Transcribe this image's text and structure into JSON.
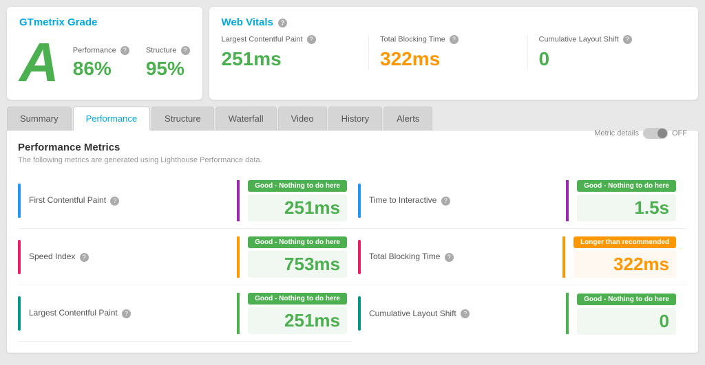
{
  "header": {
    "grade_title": "GTmetrix Grade",
    "grade_letter": "A",
    "performance_label": "Performance",
    "performance_value": "86%",
    "structure_label": "Structure",
    "structure_value": "95%",
    "web_vitals_title": "Web Vitals",
    "lcp_label": "Largest Contentful Paint",
    "lcp_value": "251ms",
    "tbt_label": "Total Blocking Time",
    "tbt_value": "322ms",
    "cls_label": "Cumulative Layout Shift",
    "cls_value": "0"
  },
  "tabs": [
    {
      "label": "Summary",
      "active": false
    },
    {
      "label": "Performance",
      "active": true
    },
    {
      "label": "Structure",
      "active": false
    },
    {
      "label": "Waterfall",
      "active": false
    },
    {
      "label": "Video",
      "active": false
    },
    {
      "label": "History",
      "active": false
    },
    {
      "label": "Alerts",
      "active": false
    }
  ],
  "performance": {
    "title": "Performance Metrics",
    "subtitle": "The following metrics are generated using Lighthouse Performance data.",
    "metric_details_label": "Metric details",
    "toggle_label": "OFF",
    "metrics": [
      {
        "name": "First Contentful Paint",
        "badge": "Good - Nothing to do here",
        "badge_type": "green",
        "value": "251ms",
        "value_type": "green",
        "bar_color": "blue",
        "sep_color": "purple"
      },
      {
        "name": "Time to Interactive",
        "badge": "Good - Nothing to do here",
        "badge_type": "green",
        "value": "1.5s",
        "value_type": "green",
        "bar_color": "blue",
        "sep_color": "purple"
      },
      {
        "name": "Speed Index",
        "badge": "Good - Nothing to do here",
        "badge_type": "green",
        "value": "753ms",
        "value_type": "green",
        "bar_color": "pink",
        "sep_color": "orange"
      },
      {
        "name": "Total Blocking Time",
        "badge": "Longer than recommended",
        "badge_type": "orange",
        "value": "322ms",
        "value_type": "orange",
        "bar_color": "pink",
        "sep_color": "orange"
      },
      {
        "name": "Largest Contentful Paint",
        "badge": "Good - Nothing to do here",
        "badge_type": "green",
        "value": "251ms",
        "value_type": "green",
        "bar_color": "teal",
        "sep_color": "green"
      },
      {
        "name": "Cumulative Layout Shift",
        "badge": "Good - Nothing to do here",
        "badge_type": "green",
        "value": "0",
        "value_type": "green",
        "bar_color": "teal",
        "sep_color": "green"
      }
    ]
  }
}
